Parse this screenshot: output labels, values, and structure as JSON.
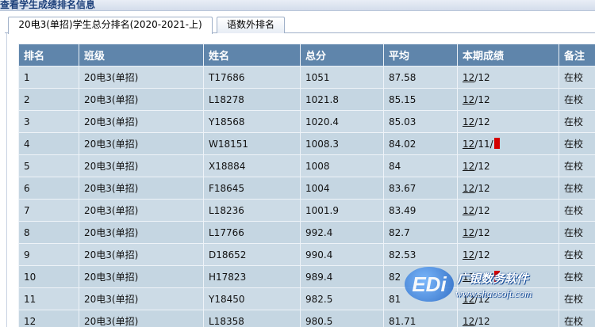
{
  "window": {
    "title": "查看学生成绩排名信息"
  },
  "tabs": [
    {
      "label": "20电3(单招)学生总分排名(2020-2021-上)",
      "active": true
    },
    {
      "label": "语数外排名",
      "active": false
    }
  ],
  "table": {
    "headers": [
      "排名",
      "班级",
      "姓名",
      "总分",
      "平均",
      "本期成绩",
      "备注"
    ],
    "rows": [
      {
        "rank": "1",
        "class": "20电3(单招)",
        "name": "T17686",
        "total": "1051",
        "avg": "87.58",
        "term_a": "12",
        "term_b": "/12",
        "note": "在校"
      },
      {
        "rank": "2",
        "class": "20电3(单招)",
        "name": "L18278",
        "total": "1021.8",
        "avg": "85.15",
        "term_a": "12",
        "term_b": "/12",
        "note": "在校"
      },
      {
        "rank": "3",
        "class": "20电3(单招)",
        "name": "Y18568",
        "total": "1020.4",
        "avg": "85.03",
        "term_a": "12",
        "term_b": "/12",
        "note": "在校"
      },
      {
        "rank": "4",
        "class": "20电3(单招)",
        "name": "W18151",
        "total": "1008.3",
        "avg": "84.02",
        "term_a": "12",
        "term_b": "/11/",
        "note": "在校",
        "flag": true
      },
      {
        "rank": "5",
        "class": "20电3(单招)",
        "name": "X18884",
        "total": "1008",
        "avg": "84",
        "term_a": "12",
        "term_b": "/12",
        "note": "在校"
      },
      {
        "rank": "6",
        "class": "20电3(单招)",
        "name": "F18645",
        "total": "1004",
        "avg": "83.67",
        "term_a": "12",
        "term_b": "/12",
        "note": "在校"
      },
      {
        "rank": "7",
        "class": "20电3(单招)",
        "name": "L18236",
        "total": "1001.9",
        "avg": "83.49",
        "term_a": "12",
        "term_b": "/12",
        "note": "在校"
      },
      {
        "rank": "8",
        "class": "20电3(单招)",
        "name": "L17766",
        "total": "992.4",
        "avg": "82.7",
        "term_a": "12",
        "term_b": "/12",
        "note": "在校"
      },
      {
        "rank": "9",
        "class": "20电3(单招)",
        "name": "D18652",
        "total": "990.4",
        "avg": "82.53",
        "term_a": "12",
        "term_b": "/12",
        "note": "在校"
      },
      {
        "rank": "10",
        "class": "20电3(单招)",
        "name": "H17823",
        "total": "989.4",
        "avg": "82",
        "term_a": "12",
        "term_b": "/11/",
        "note": "在校",
        "flag": true
      },
      {
        "rank": "11",
        "class": "20电3(单招)",
        "name": "Y18450",
        "total": "982.5",
        "avg": "81",
        "term_a": "12",
        "term_b": "/12",
        "note": "在校"
      },
      {
        "rank": "12",
        "class": "20电3(单招)",
        "name": "L18358",
        "total": "980.5",
        "avg": "81.71",
        "term_a": "12",
        "term_b": "/12",
        "note": "在校"
      }
    ]
  },
  "watermark": {
    "logo": "EDi",
    "text": "广银数务软件",
    "url": "www.shaosoft.com"
  },
  "colors": {
    "header": "#5f85ab",
    "row": "#ccdbe6",
    "flag": "#d40000"
  }
}
